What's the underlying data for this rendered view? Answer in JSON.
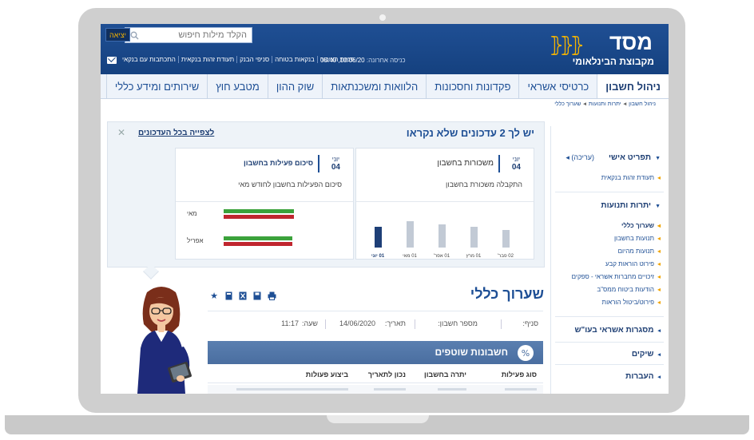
{
  "header": {
    "logo_name": "מסד",
    "logo_sub": "מקבוצת הבינלאומי",
    "search_placeholder": "הקלד מילות חיפוש",
    "exit_label": "יציאה",
    "last_login_label": "כניסה אחרונה:",
    "last_login_value": "10/06/20, 08:40",
    "links": [
      "פניות הציבור",
      "בנקאות בטוחה",
      "סניפי הבנק",
      "תעודת זהות בנקאית",
      "התכתבות עם בנקאי"
    ]
  },
  "nav": {
    "tabs": [
      "ניהול חשבון",
      "כרטיסי אשראי",
      "פקדונות וחסכונות",
      "הלוואות ומשכנתאות",
      "שוק ההון",
      "מטבע חוץ",
      "שירותים ומידע כללי"
    ]
  },
  "breadcrumb": [
    "ניהול חשבון",
    "יתרות ותנועות",
    "שערוך כללי"
  ],
  "sidebar": {
    "personal": {
      "label": "תפריט אישי",
      "edit": "(עריכה)",
      "items": [
        "תעודת זהות בנקאית"
      ]
    },
    "balances": {
      "label": "יתרות ותנועות",
      "items": [
        "שערוך כללי",
        "תנועות בחשבון",
        "תנועות מהיום",
        "פירוט הוראות קבע",
        "זיכויים מחברות אשראי - ספקים",
        "הודעות ביטוח ממס\"ב",
        "פירוט/ביטול הוראות"
      ]
    },
    "credit": {
      "label": "מסגרות אשראי בעו\"ש"
    },
    "checks": {
      "label": "שיקים"
    },
    "transfers": {
      "label": "העברות"
    }
  },
  "updates": {
    "title": "יש לך 2 עדכונים שלא נקראו",
    "view_all": "לצפייה בכל העדכונים",
    "cards": [
      {
        "month": "יוני",
        "day": "04",
        "title": "משכורות בחשבון",
        "text": "התקבלה משכורת בחשבון",
        "bars": [
          {
            "label": "02 פבר'",
            "value": 0.45
          },
          {
            "label": "01 מרץ",
            "value": 0.55
          },
          {
            "label": "01 אפר'",
            "value": 0.6
          },
          {
            "label": "01 מאי",
            "value": 0.68
          },
          {
            "label": "01 יוני",
            "value": 0.55,
            "current": true
          }
        ]
      },
      {
        "month": "יוני",
        "day": "04",
        "title": "סיכום פעילות בחשבון",
        "text": "סיכום הפעילות בחשבון לחודש מאי",
        "rows": [
          {
            "label": "מאי",
            "green": 0.92,
            "red": 0.92
          },
          {
            "label": "אפריל",
            "green": 0.9,
            "red": 0.9
          }
        ]
      }
    ]
  },
  "main": {
    "title": "שערוך כללי",
    "branch_label": "סניף:",
    "account_label": "מספר חשבון:",
    "date_label": "תאריך:",
    "date_value": "14/06/2020",
    "time_label": "שעה:",
    "time_value": "11:17",
    "accounts_title": "חשבונות שוטפים",
    "columns": [
      "סוג פעילות",
      "יתרה בחשבון",
      "נכון לתאריך",
      "ביצוע פעולות"
    ]
  },
  "colors": {
    "brand_blue": "#1e4f95",
    "brand_yellow": "#f5b400",
    "bar_green": "#3ba23b",
    "bar_red": "#c0262f"
  }
}
